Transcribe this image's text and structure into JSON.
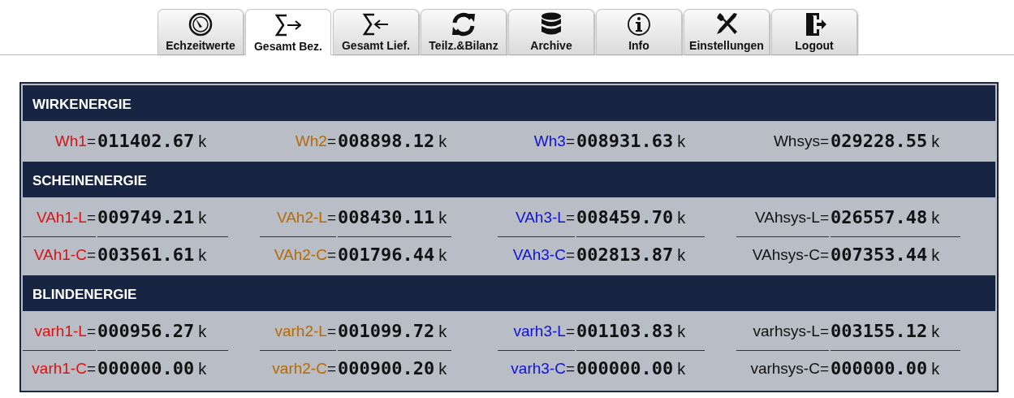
{
  "tabs": [
    {
      "label": "Echzeitwerte",
      "selected": false
    },
    {
      "label": "Gesamt Bez.",
      "selected": true
    },
    {
      "label": "Gesamt Lief.",
      "selected": false
    },
    {
      "label": "Teilz.&Bilanz",
      "selected": false
    },
    {
      "label": "Archive",
      "selected": false
    },
    {
      "label": "Info",
      "selected": false
    },
    {
      "label": "Einstellungen",
      "selected": false
    },
    {
      "label": "Logout",
      "selected": false
    }
  ],
  "sections": [
    {
      "title": "WIRKENERGIE",
      "rows": [
        [
          {
            "label": "Wh1",
            "sign": "=",
            "color": "#e01010",
            "value": "011402.67",
            "unit": "k"
          },
          {
            "label": "Wh2",
            "sign": "=",
            "color": "#b86a00",
            "value": "008898.12",
            "unit": "k"
          },
          {
            "label": "Wh3",
            "sign": "=",
            "color": "#1010d8",
            "value": "008931.63",
            "unit": "k"
          },
          {
            "label": "Whsys=",
            "color": "#111111",
            "value": "029228.55",
            "unit": "k"
          }
        ]
      ]
    },
    {
      "title": "SCHEINENERGIE",
      "rows": [
        [
          {
            "label": "VAh1-L",
            "sign": "=",
            "color": "#e01010",
            "value": "009749.21",
            "unit": "k"
          },
          {
            "label": "VAh2-L",
            "sign": "=",
            "color": "#b86a00",
            "value": "008430.11",
            "unit": "k"
          },
          {
            "label": "VAh3-L",
            "sign": "=",
            "color": "#1010d8",
            "value": "008459.70",
            "unit": "k"
          },
          {
            "label": "VAhsys-L=",
            "color": "#111111",
            "value": "026557.48",
            "unit": "k"
          }
        ],
        [
          {
            "label": "VAh1-C",
            "sign": "=",
            "color": "#e01010",
            "value": "003561.61",
            "unit": "k"
          },
          {
            "label": "VAh2-C",
            "sign": "=",
            "color": "#b86a00",
            "value": "001796.44",
            "unit": "k"
          },
          {
            "label": "VAh3-C",
            "sign": "=",
            "color": "#1010d8",
            "value": "002813.87",
            "unit": "k"
          },
          {
            "label": "VAhsys-C=",
            "color": "#111111",
            "value": "007353.44",
            "unit": "k"
          }
        ]
      ]
    },
    {
      "title": "BLINDENERGIE",
      "rows": [
        [
          {
            "label": "varh1-L",
            "sign": "=",
            "color": "#e01010",
            "value": "000956.27",
            "unit": "k"
          },
          {
            "label": "varh2-L",
            "sign": "=",
            "color": "#b86a00",
            "value": "001099.72",
            "unit": "k"
          },
          {
            "label": "varh3-L",
            "sign": "=",
            "color": "#1010d8",
            "value": "001103.83",
            "unit": "k"
          },
          {
            "label": "varhsys-L=",
            "color": "#111111",
            "value": "003155.12",
            "unit": "k"
          }
        ],
        [
          {
            "label": "varh1-C",
            "sign": "=",
            "color": "#e01010",
            "value": "000000.00",
            "unit": "k"
          },
          {
            "label": "varh2-C",
            "sign": "=",
            "color": "#b86a00",
            "value": "000900.20",
            "unit": "k"
          },
          {
            "label": "varh3-C",
            "sign": "=",
            "color": "#1010d8",
            "value": "000000.00",
            "unit": "k"
          },
          {
            "label": "varhsys-C=",
            "color": "#111111",
            "value": "000000.00",
            "unit": "k"
          }
        ]
      ]
    }
  ]
}
